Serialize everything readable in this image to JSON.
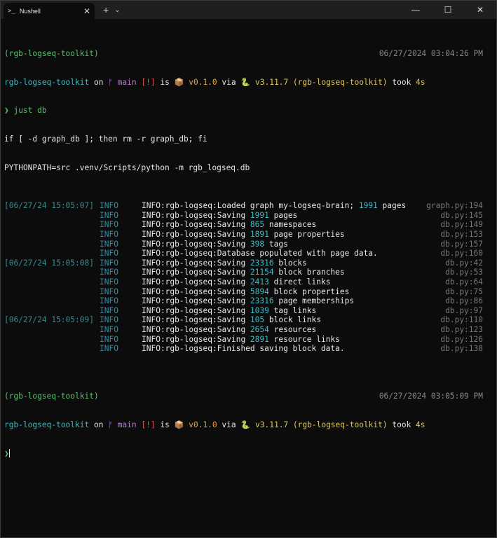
{
  "window": {
    "tab_icon": ">_",
    "tab_title": "Nushell",
    "tab_close": "✕",
    "new_tab": "+",
    "dropdown": "⌄",
    "minimize": "—",
    "maximize": "☐",
    "close": "✕"
  },
  "prompt1": {
    "venv": "(rgb-logseq-toolkit)",
    "time": "06/27/2024 03:04:26 PM",
    "dir": "rgb-logseq-toolkit",
    "on": " on ",
    "branch_icon": "ᚠ",
    "branch": "main",
    "status": "[!]",
    "is": " is ",
    "pkg_icon": "📦",
    "version": "v0.1.0",
    "via": " via ",
    "py_icon": "🐍",
    "python": "v3.11.7 (rgb-logseq-toolkit)",
    "took": " took ",
    "duration": "4s",
    "symbol": "❯",
    "command": "just db"
  },
  "echo_lines": [
    "if [ -d graph_db ]; then rm -r graph_db; fi",
    "PYTHONPATH=src .venv/Scripts/python -m rgb_logseq.db"
  ],
  "log_lines": [
    {
      "ts": "[06/27/24 15:05:07]",
      "level": "INFO",
      "pre": "INFO:rgb-logseq:Loaded graph my-logseq-brain; ",
      "num": "1991",
      "post": " pages",
      "file": "graph.py:194"
    },
    {
      "ts": "",
      "level": "INFO",
      "pre": "INFO:rgb-logseq:Saving ",
      "num": "1991",
      "post": " pages",
      "file": "db.py:145"
    },
    {
      "ts": "",
      "level": "INFO",
      "pre": "INFO:rgb-logseq:Saving ",
      "num": "865",
      "post": " namespaces",
      "file": "db.py:149"
    },
    {
      "ts": "",
      "level": "INFO",
      "pre": "INFO:rgb-logseq:Saving ",
      "num": "1891",
      "post": " page properties",
      "file": "db.py:153"
    },
    {
      "ts": "",
      "level": "INFO",
      "pre": "INFO:rgb-logseq:Saving ",
      "num": "398",
      "post": " tags",
      "file": "db.py:157"
    },
    {
      "ts": "",
      "level": "INFO",
      "pre": "INFO:rgb-logseq:Database populated with page data.",
      "num": "",
      "post": "",
      "file": "db.py:160"
    },
    {
      "ts": "[06/27/24 15:05:08]",
      "level": "INFO",
      "pre": "INFO:rgb-logseq:Saving ",
      "num": "23316",
      "post": " blocks",
      "file": "db.py:42"
    },
    {
      "ts": "",
      "level": "INFO",
      "pre": "INFO:rgb-logseq:Saving ",
      "num": "21154",
      "post": " block branches",
      "file": "db.py:53"
    },
    {
      "ts": "",
      "level": "INFO",
      "pre": "INFO:rgb-logseq:Saving ",
      "num": "2413",
      "post": " direct links",
      "file": "db.py:64"
    },
    {
      "ts": "",
      "level": "INFO",
      "pre": "INFO:rgb-logseq:Saving ",
      "num": "5894",
      "post": " block properties",
      "file": "db.py:75"
    },
    {
      "ts": "",
      "level": "INFO",
      "pre": "INFO:rgb-logseq:Saving ",
      "num": "23316",
      "post": " page memberships",
      "file": "db.py:86"
    },
    {
      "ts": "",
      "level": "INFO",
      "pre": "INFO:rgb-logseq:Saving ",
      "num": "1039",
      "post": " tag links",
      "file": "db.py:97"
    },
    {
      "ts": "[06/27/24 15:05:09]",
      "level": "INFO",
      "pre": "INFO:rgb-logseq:Saving ",
      "num": "105",
      "post": " block links",
      "file": "db.py:110"
    },
    {
      "ts": "",
      "level": "INFO",
      "pre": "INFO:rgb-logseq:Saving ",
      "num": "2654",
      "post": " resources",
      "file": "db.py:123"
    },
    {
      "ts": "",
      "level": "INFO",
      "pre": "INFO:rgb-logseq:Saving ",
      "num": "2891",
      "post": " resource links",
      "file": "db.py:126"
    },
    {
      "ts": "",
      "level": "INFO",
      "pre": "INFO:rgb-logseq:Finished saving block data.",
      "num": "",
      "post": "",
      "file": "db.py:138"
    }
  ],
  "prompt2": {
    "venv": "(rgb-logseq-toolkit)",
    "time": "06/27/2024 03:05:09 PM",
    "dir": "rgb-logseq-toolkit",
    "on": " on ",
    "branch_icon": "ᚠ",
    "branch": "main",
    "status": "[!]",
    "is": " is ",
    "pkg_icon": "📦",
    "version": "v0.1.0",
    "via": " via ",
    "py_icon": "🐍",
    "python": "v3.11.7 (rgb-logseq-toolkit)",
    "took": " took ",
    "duration": "4s",
    "symbol": "❯"
  }
}
